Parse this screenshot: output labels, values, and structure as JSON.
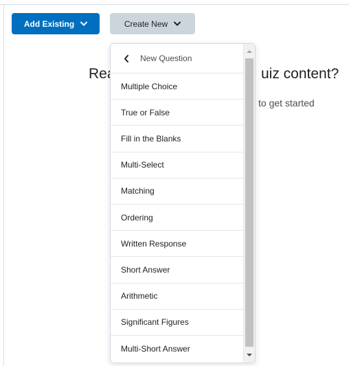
{
  "toolbar": {
    "add_existing_label": "Add Existing",
    "create_new_label": "Create New"
  },
  "background": {
    "heading_left": "Rea",
    "heading_right": "uiz content?",
    "subtext": "to get started"
  },
  "menu": {
    "header_label": "New Question",
    "items": [
      {
        "label": "Multiple Choice"
      },
      {
        "label": "True or False"
      },
      {
        "label": "Fill in the Blanks"
      },
      {
        "label": "Multi-Select"
      },
      {
        "label": "Matching"
      },
      {
        "label": "Ordering"
      },
      {
        "label": "Written Response"
      },
      {
        "label": "Short Answer"
      },
      {
        "label": "Arithmetic"
      },
      {
        "label": "Significant Figures"
      },
      {
        "label": "Multi-Short Answer"
      }
    ]
  },
  "icons": {
    "dropdown": "chevron-down-icon",
    "back": "chevron-left-icon"
  },
  "colors": {
    "primary": "#006fbf",
    "secondary": "#cdd5dc"
  }
}
